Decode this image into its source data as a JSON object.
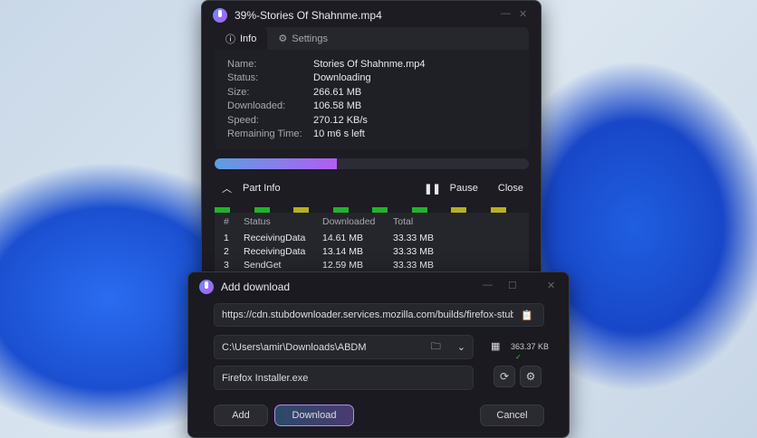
{
  "download_window": {
    "title": "39%-Stories Of Shahnme.mp4",
    "tabs": [
      {
        "label": "Info",
        "icon": "info-icon"
      },
      {
        "label": "Settings",
        "icon": "gear-icon"
      }
    ],
    "info": [
      {
        "key": "Name:",
        "value": "Stories Of Shahnme.mp4"
      },
      {
        "key": "Status:",
        "value": "Downloading"
      },
      {
        "key": "Size:",
        "value": "266.61 MB"
      },
      {
        "key": "Downloaded:",
        "value": "106.58 MB"
      },
      {
        "key": "Speed:",
        "value": "270.12 KB/s"
      },
      {
        "key": "Remaining Time:",
        "value": "10 m6 s left"
      }
    ],
    "progress_percent": 39,
    "part_info_label": "Part Info",
    "pause_label": "Pause",
    "close_label": "Close",
    "segment_colors": [
      "#22b32a",
      "#22b32a",
      "#b5b022",
      "#22b32a",
      "#22b32a",
      "#22b32a",
      "#b5b022",
      "#b5b022"
    ],
    "parts": {
      "headers": [
        "#",
        "Status",
        "Downloaded",
        "Total"
      ],
      "rows": [
        [
          "1",
          "ReceivingData",
          "14.61 MB",
          "33.33 MB"
        ],
        [
          "2",
          "ReceivingData",
          "13.14 MB",
          "33.33 MB"
        ],
        [
          "3",
          "SendGet",
          "12.59 MB",
          "33.33 MB"
        ]
      ]
    }
  },
  "add_window": {
    "title": "Add download",
    "url": "https://cdn.stubdownloader.services.mozilla.com/builds/firefox-stub/er",
    "folder": "C:\\Users\\amir\\Downloads\\ABDM",
    "filename": "Firefox Installer.exe",
    "size": "363.37 KB",
    "add_label": "Add",
    "download_label": "Download",
    "cancel_label": "Cancel"
  }
}
